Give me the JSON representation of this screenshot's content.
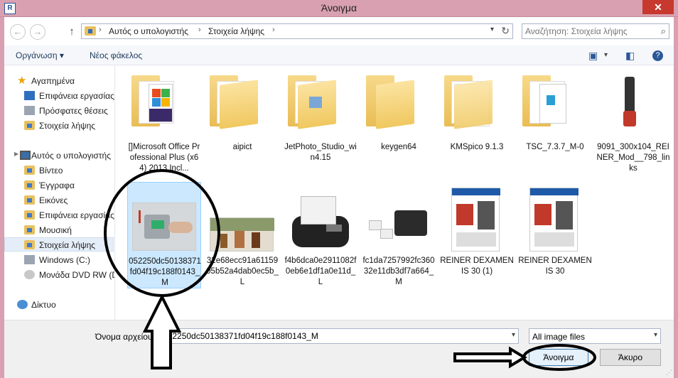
{
  "window": {
    "title": "Άνοιγμα",
    "close_glyph": "✕",
    "app_icon_letter": "R"
  },
  "address": {
    "back_glyph": "←",
    "forward_glyph": "→",
    "up_glyph": "↑",
    "crumbs": [
      "Αυτός ο υπολογιστής",
      "Στοιχεία λήψης"
    ],
    "separator": "›",
    "search_placeholder": "Αναζήτηση: Στοιχεία λήψης"
  },
  "toolbar": {
    "organize": "Οργάνωση ▾",
    "new_folder": "Νέος φάκελος"
  },
  "nav": {
    "items": [
      {
        "label": "Αγαπημένα",
        "icon": "star-icon"
      },
      {
        "label": "Επιφάνεια εργασίας",
        "icon": "desktop-icon"
      },
      {
        "label": "Πρόσφατες θέσεις",
        "icon": "recent-places-icon"
      },
      {
        "label": "Στοιχεία λήψης",
        "icon": "downloads-icon"
      },
      {
        "label": "Αυτός ο υπολογιστής",
        "icon": "computer-icon"
      },
      {
        "label": "Βίντεο",
        "icon": "videos-icon"
      },
      {
        "label": "Έγγραφα",
        "icon": "documents-icon"
      },
      {
        "label": "Εικόνες",
        "icon": "pictures-icon"
      },
      {
        "label": "Επιφάνεια εργασίας",
        "icon": "desktop-icon"
      },
      {
        "label": "Μουσική",
        "icon": "music-icon"
      },
      {
        "label": "Στοιχεία λήψης",
        "icon": "downloads-icon"
      },
      {
        "label": "Windows (C:)",
        "icon": "drive-icon"
      },
      {
        "label": "Μονάδα DVD RW (D",
        "icon": "dvd-icon"
      },
      {
        "label": "Δίκτυο",
        "icon": "network-icon"
      }
    ]
  },
  "files": [
    {
      "name": "[]Microsoft Office Professional Plus (x64) 2013 Incl...",
      "kind": "folder"
    },
    {
      "name": "aipict",
      "kind": "folder"
    },
    {
      "name": "JetPhoto_Studio_win4.15",
      "kind": "folder"
    },
    {
      "name": "keygen64",
      "kind": "folder"
    },
    {
      "name": "KMSpico 9.1.3",
      "kind": "folder"
    },
    {
      "name": "TSC_7.3.7_M-0",
      "kind": "folder"
    },
    {
      "name": "9091_300x104_REINER_Mod__798_links",
      "kind": "image"
    },
    {
      "name": "052250dc50138371fd04f19c188f0143_M",
      "kind": "image"
    },
    {
      "name": "32e68ecc91a6115905b52a4dab0ec5b_L",
      "kind": "image"
    },
    {
      "name": "f4b6dca0e2911082f0eb6e1df1a0e11d_L",
      "kind": "image"
    },
    {
      "name": "fc1da7257992fc36032e11db3df7a664_M",
      "kind": "image"
    },
    {
      "name": "REINER DEXAMENIS 30 (1)",
      "kind": "image"
    },
    {
      "name": "REINER DEXAMENIS 30",
      "kind": "image"
    }
  ],
  "footer": {
    "filename_label": "Όνομα αρχείου:",
    "filename_value": "052250dc50138371fd04f19c188f0143_M",
    "filter_value": "All image files",
    "open_button": "Άνοιγμα",
    "cancel_button": "Άκυρο"
  },
  "colors": {
    "titlebar": "#d8a0b0",
    "close": "#c7382e",
    "selection": "#cce8ff",
    "accent": "#2b5797"
  }
}
